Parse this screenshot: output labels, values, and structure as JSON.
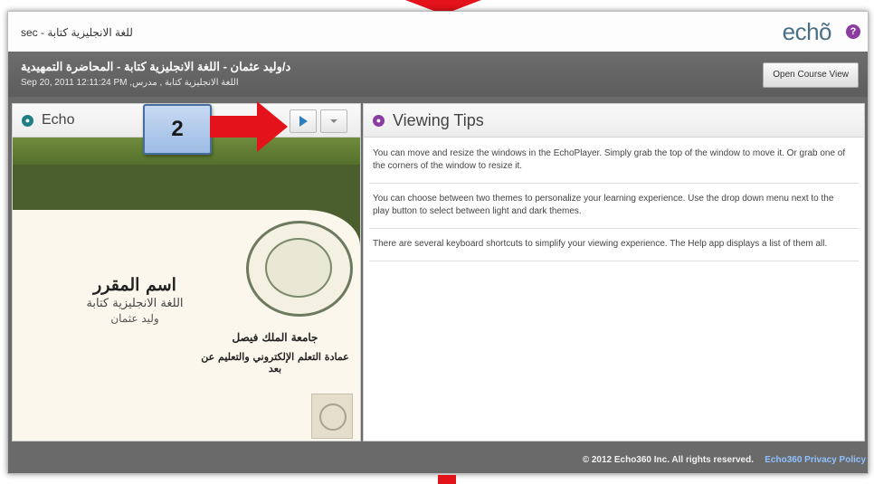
{
  "topbar": {
    "course_crumb": "sec - للغة الانجليزية كتابة",
    "brand": "echõ",
    "help_glyph": "?"
  },
  "header": {
    "title": "د/وليد عثمان - اللغة الانجليزية كتابة - المحاضرة التمهيدية",
    "subtitle": "Sep 20, 2011 12:11:24 PM ,اللغة الانجليزية كتابة , مدرس",
    "open_course_label": "Open Course View"
  },
  "echo_panel": {
    "title": "Echo",
    "icon": "echo-icon",
    "accent": "#1f7f86"
  },
  "slide": {
    "course_name": "اسم المقرر",
    "course_subject": "اللغة الانجليزية كتابة",
    "instructor": "وليد عثمان",
    "university": "جامعة الملك فيصل",
    "deanship": "عمادة التعلم الإلكتروني والتعليم عن بعد"
  },
  "tips_panel": {
    "title": "Viewing Tips",
    "icon": "lightbulb-icon",
    "accent": "#8a3ca0",
    "tips": [
      "You can move and resize the windows in the EchoPlayer. Simply grab the top of the window to move it. Or grab one of the corners of the window to resize it.",
      "You can choose between two themes to personalize your learning experience. Use the drop down menu next to the play button to select between light and dark themes.",
      "There are several keyboard shortcuts to simplify your viewing experience. The Help app displays a list of them all."
    ]
  },
  "footer": {
    "copyright": "© 2012 Echo360 Inc. All rights reserved.",
    "privacy": "Echo360 Privacy Policy"
  },
  "annotation": {
    "step_number": "2",
    "color": "#e3121b"
  }
}
